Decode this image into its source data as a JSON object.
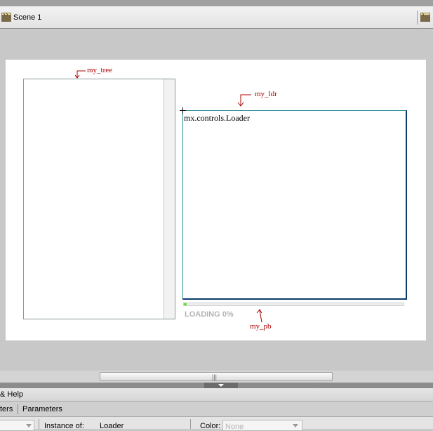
{
  "scene": {
    "label": "Scene 1"
  },
  "stage": {
    "loader_class": "mx.controls.Loader",
    "progress": {
      "label": "LOADING 0%",
      "fraction": 0.01
    }
  },
  "annotations": {
    "tree": "my_tree",
    "loader": "my_ldr",
    "progress": "my_pb"
  },
  "scrollbar": {
    "grip": "|||"
  },
  "bottom_panel": {
    "title": "& Help",
    "tabs": [
      "ters",
      "Parameters"
    ],
    "instance_label": "Instance of:",
    "instance_value": "Loader",
    "color_label": "Color:",
    "color_value": "None"
  },
  "colors": {
    "annotation": "#aa0000",
    "loader_border": "#2a8c96",
    "progress_fill": "#66dd33"
  }
}
